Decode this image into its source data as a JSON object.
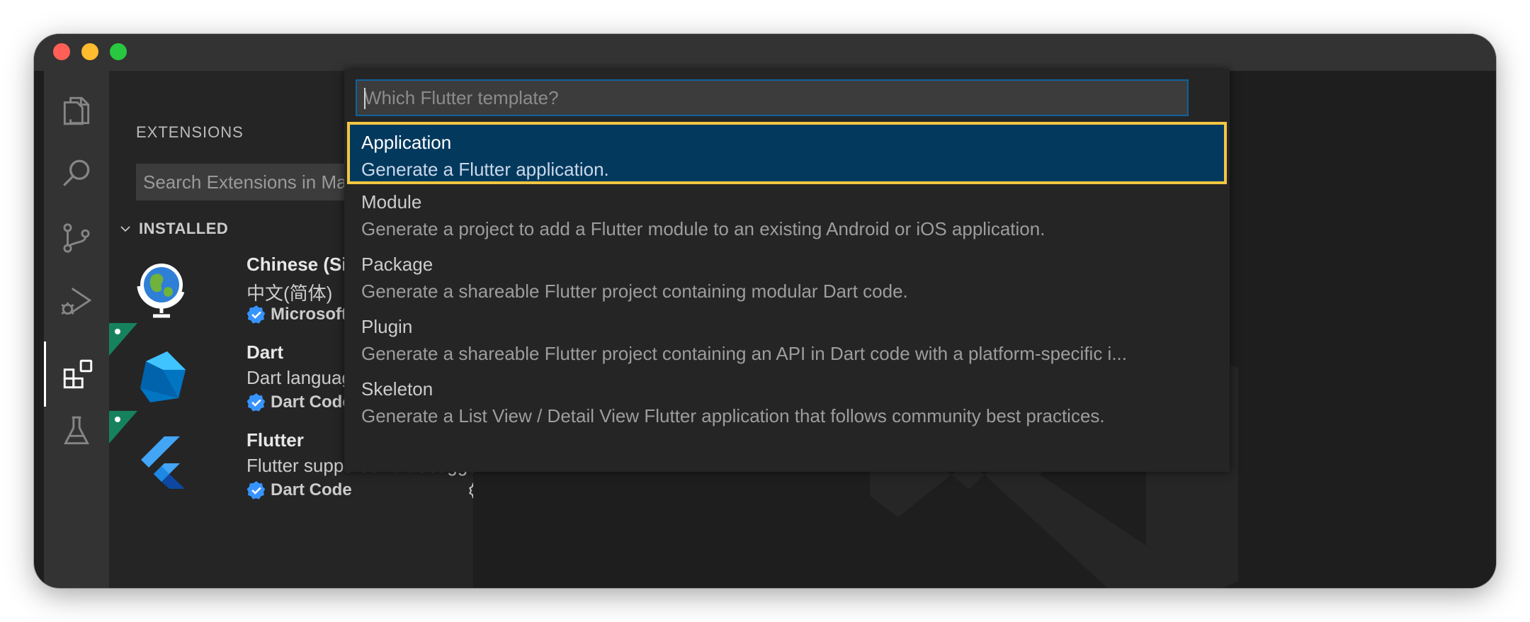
{
  "window": {
    "title": ""
  },
  "activity_bar": {
    "items": [
      {
        "name": "explorer-icon",
        "active": false
      },
      {
        "name": "search-icon",
        "active": false
      },
      {
        "name": "source-control-icon",
        "active": false
      },
      {
        "name": "run-debug-icon",
        "active": false
      },
      {
        "name": "extensions-icon",
        "active": true
      },
      {
        "name": "testing-icon",
        "active": false
      }
    ]
  },
  "sidebar": {
    "title": "EXTENSIONS",
    "search_value": "Search Extensions in Marketplace",
    "section": "INSTALLED",
    "extensions": [
      {
        "name": "Chinese (Simplified)",
        "description": "中文(简体)",
        "publisher": "Microsoft",
        "icon": "globe-icon",
        "pinned": false
      },
      {
        "name": "Dart",
        "description": "Dart language support",
        "publisher": "Dart Code",
        "icon": "dart-logo-icon",
        "pinned": true
      },
      {
        "name": "Flutter",
        "description": "Flutter support and debugger",
        "publisher": "Dart Code",
        "icon": "flutter-logo-icon",
        "pinned": true
      }
    ]
  },
  "quick_pick": {
    "placeholder": "Which Flutter template?",
    "items": [
      {
        "label": "Application",
        "detail": "Generate a Flutter application.",
        "selected": true
      },
      {
        "label": "Module",
        "detail": "Generate a project to add a Flutter module to an existing Android or iOS application.",
        "selected": false
      },
      {
        "label": "Package",
        "detail": "Generate a shareable Flutter project containing modular Dart code.",
        "selected": false
      },
      {
        "label": "Plugin",
        "detail": "Generate a shareable Flutter project containing an API in Dart code with a platform-specific i...",
        "selected": false
      },
      {
        "label": "Skeleton",
        "detail": "Generate a List View / Detail View Flutter application that follows community best practices.",
        "selected": false
      }
    ]
  },
  "colors": {
    "selection_border": "#f3c641",
    "selection_background": "#04395e",
    "input_border": "#0e639c",
    "verified_badge": "#3794ff",
    "pin_badge": "#16825d"
  }
}
